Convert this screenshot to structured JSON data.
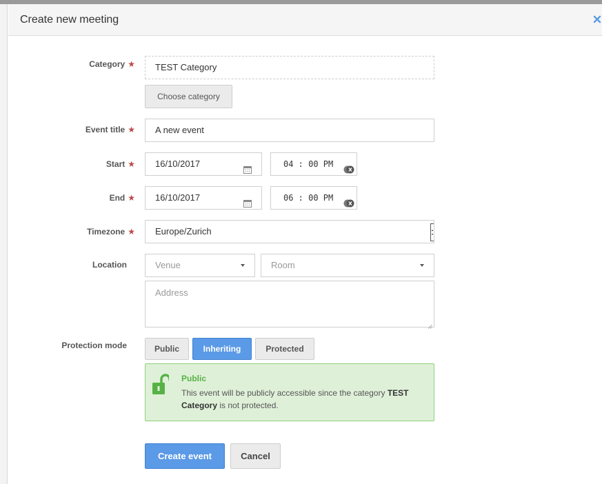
{
  "dialog": {
    "title": "Create new meeting"
  },
  "form": {
    "category": {
      "label": "Category",
      "value": "TEST Category",
      "choose_label": "Choose category"
    },
    "event_title": {
      "label": "Event title",
      "value": "A new event"
    },
    "start": {
      "label": "Start",
      "date": "16/10/2017",
      "time": "04 : 00  PM"
    },
    "end": {
      "label": "End",
      "date": "16/10/2017",
      "time": "06 : 00  PM"
    },
    "timezone": {
      "label": "Timezone",
      "value": "Europe/Zurich"
    },
    "location": {
      "label": "Location",
      "venue_placeholder": "Venue",
      "room_placeholder": "Room",
      "address_placeholder": "Address"
    },
    "required_marker": "★",
    "protection": {
      "label": "Protection mode",
      "options": [
        "Public",
        "Inheriting",
        "Protected"
      ],
      "selected": "Inheriting",
      "info_title": "Public",
      "info_text_prefix": "This event will be publicly accessible since the category",
      "info_category": "TEST Category",
      "info_text_suffix": "is not protected."
    }
  },
  "actions": {
    "create_label": "Create event",
    "cancel_label": "Cancel"
  },
  "colors": {
    "primary": "#5b9ae6",
    "required": "#b94a48",
    "success_bg": "#dff0d8",
    "success_text": "#56b246"
  }
}
